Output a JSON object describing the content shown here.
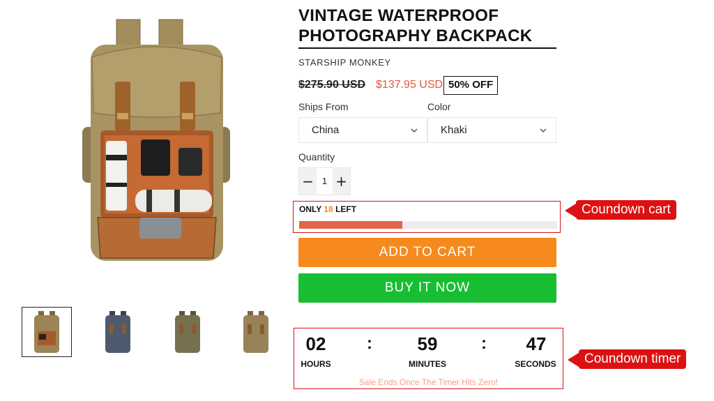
{
  "product": {
    "title_line1": "VINTAGE WATERPROOF",
    "title_line2": "PHOTOGRAPHY BACKPACK",
    "vendor": "STARSHIP MONKEY",
    "price_compare": "$275.90 USD",
    "price_sale": "$137.95 USD",
    "sale_badge": "50% OFF"
  },
  "options": {
    "ships_from": {
      "label": "Ships From",
      "value": "China"
    },
    "color": {
      "label": "Color",
      "value": "Khaki"
    }
  },
  "quantity": {
    "label": "Quantity",
    "value": "1",
    "minus": "−",
    "plus": "+"
  },
  "stock": {
    "prefix": "ONLY",
    "count": "18",
    "suffix": "LEFT",
    "fill_fraction": 0.4
  },
  "buttons": {
    "add_to_cart": "ADD TO CART",
    "buy_now": "BUY IT NOW"
  },
  "timer": {
    "hours": "02",
    "minutes": "59",
    "seconds": "47",
    "separator": ":",
    "hours_label": "HOURS",
    "minutes_label": "MINUTES",
    "seconds_label": "SECONDS",
    "message": "Sale Ends Once The Timer Hits Zero!"
  },
  "callouts": {
    "cart": "Coundown cart",
    "timer": "Coundown timer"
  },
  "gallery": {
    "selected_index": 0,
    "thumb_colors": [
      "#9c8455",
      "#4e5a70",
      "#76704f",
      "#98825a"
    ]
  },
  "colors": {
    "sale_price": "#e05a3e",
    "add_to_cart": "#f78a1d",
    "buy_now": "#18be31",
    "stock_fill": "#df6649",
    "callout": "#dd1111"
  },
  "icons": {
    "select_chevron": "chevron-down-icon",
    "product_image": "backpack-image"
  }
}
